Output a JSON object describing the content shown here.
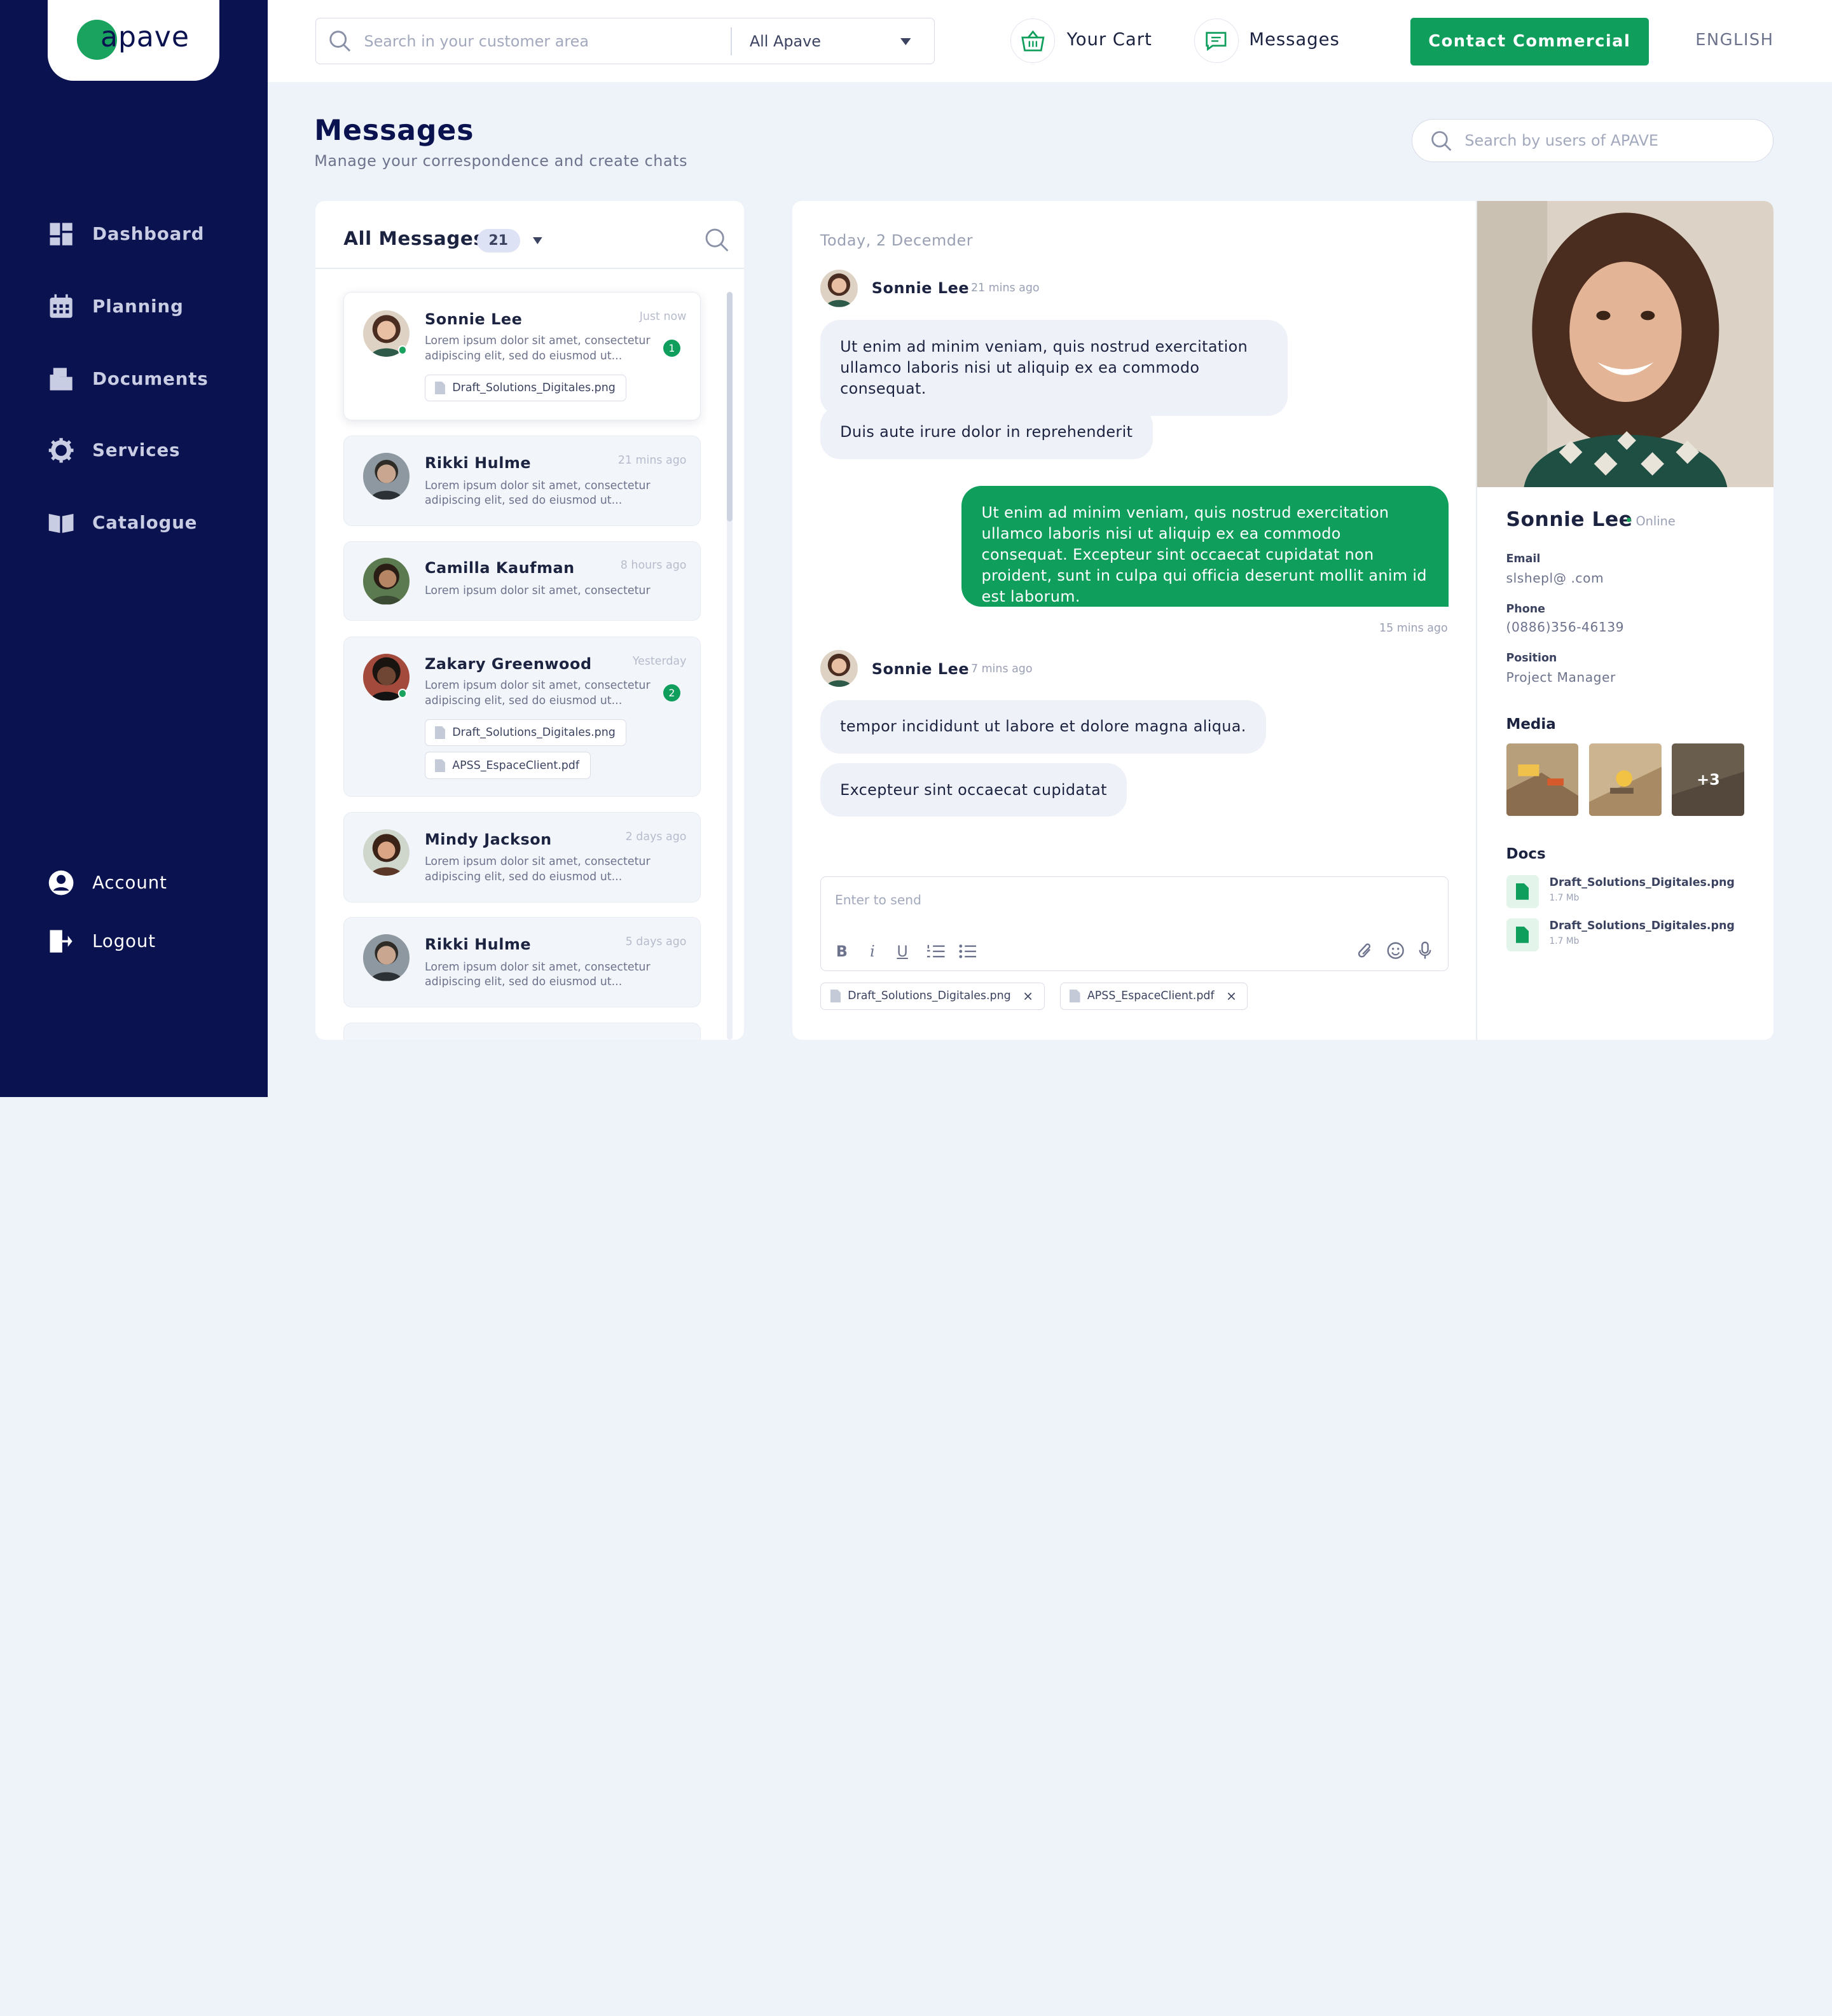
{
  "brand": {
    "name": "apave"
  },
  "sidebar": {
    "items": [
      {
        "label": "Dashboard",
        "icon": "dashboard-icon"
      },
      {
        "label": "Planning",
        "icon": "calendar-icon"
      },
      {
        "label": "Documents",
        "icon": "folder-icon"
      },
      {
        "label": "Services",
        "icon": "gear-icon"
      },
      {
        "label": "Catalogue",
        "icon": "book-icon"
      }
    ],
    "account": "Account",
    "logout": "Logout"
  },
  "topbar": {
    "search_placeholder": "Search in your customer area",
    "scope": "All Apave",
    "cart": "Your Cart",
    "messages": "Messages",
    "contact": "Contact Commercial",
    "language": "ENGLISH"
  },
  "page": {
    "title": "Messages",
    "subtitle": "Manage your correspondence and create chats",
    "user_search_placeholder": "Search by users of APAVE"
  },
  "list": {
    "title": "All Messages",
    "count": "21",
    "items": [
      {
        "name": "Sonnie Lee",
        "time": "Just now",
        "text": "Lorem ipsum dolor sit amet, consectetur adipiscing elit, sed do eiusmod ut...",
        "badge": "1",
        "files": [
          "Draft_Solutions_Digitales.png"
        ]
      },
      {
        "name": "Rikki Hulme",
        "time": "21 mins ago",
        "text": "Lorem ipsum dolor sit amet, consectetur adipiscing elit, sed do eiusmod ut..."
      },
      {
        "name": "Camilla Kaufman",
        "time": "8 hours ago",
        "text": "Lorem ipsum dolor sit amet, consectetur"
      },
      {
        "name": "Zakary Greenwood",
        "time": "Yesterday",
        "text": "Lorem ipsum dolor sit amet, consectetur adipiscing elit, sed do eiusmod ut...",
        "badge": "2",
        "files": [
          "Draft_Solutions_Digitales.png",
          "APSS_EspaceClient.pdf"
        ]
      },
      {
        "name": "Mindy Jackson",
        "time": "2 days ago",
        "text": "Lorem ipsum dolor sit amet, consectetur adipiscing elit, sed do eiusmod ut..."
      },
      {
        "name": "Rikki Hulme",
        "time": "5 days ago",
        "text": "Lorem ipsum dolor sit amet, consectetur adipiscing elit, sed do eiusmod ut..."
      }
    ]
  },
  "chat": {
    "date": "Today, 2 Decemder",
    "groups": [
      {
        "name": "Sonnie Lee",
        "ago": "21 mins ago",
        "messages": [
          "Ut enim ad minim veniam, quis nostrud exercitation ullamco laboris nisi ut aliquip ex ea commodo consequat.",
          "Duis aute irure dolor in reprehenderit"
        ]
      },
      {
        "name": "Sonnie Lee",
        "ago": "7 mins ago",
        "messages": [
          "tempor incididunt ut labore et dolore magna aliqua.",
          "Excepteur sint occaecat cupidatat"
        ]
      }
    ],
    "outgoing": {
      "text": "Ut enim ad minim veniam, quis nostrud exercitation ullamco laboris nisi ut aliquip ex ea commodo consequat. Excepteur sint occaecat cupidatat non proident, sunt in culpa qui officia deserunt mollit anim id est laborum.",
      "time": "15 mins ago"
    },
    "composer_placeholder": "Enter to send",
    "attachments": [
      "Draft_Solutions_Digitales.png",
      "APSS_EspaceClient.pdf"
    ]
  },
  "profile": {
    "name": "Sonnie Lee",
    "status": "Online",
    "email_label": "Email",
    "email": "slshepl@   .com",
    "phone_label": "Phone",
    "phone": "(0886)356-46139",
    "position_label": "Position",
    "position": "Project Manager",
    "media_label": "Media",
    "media_more": "+3",
    "docs_label": "Docs",
    "docs": [
      {
        "name": "Draft_Solutions_Digitales.png",
        "size": "1.7 Mb"
      },
      {
        "name": "Draft_Solutions_Digitales.png",
        "size": "1.7 Mb"
      }
    ]
  },
  "colors": {
    "navy": "#0a1250",
    "green": "#109e5d",
    "bg": "#eef2f9"
  }
}
